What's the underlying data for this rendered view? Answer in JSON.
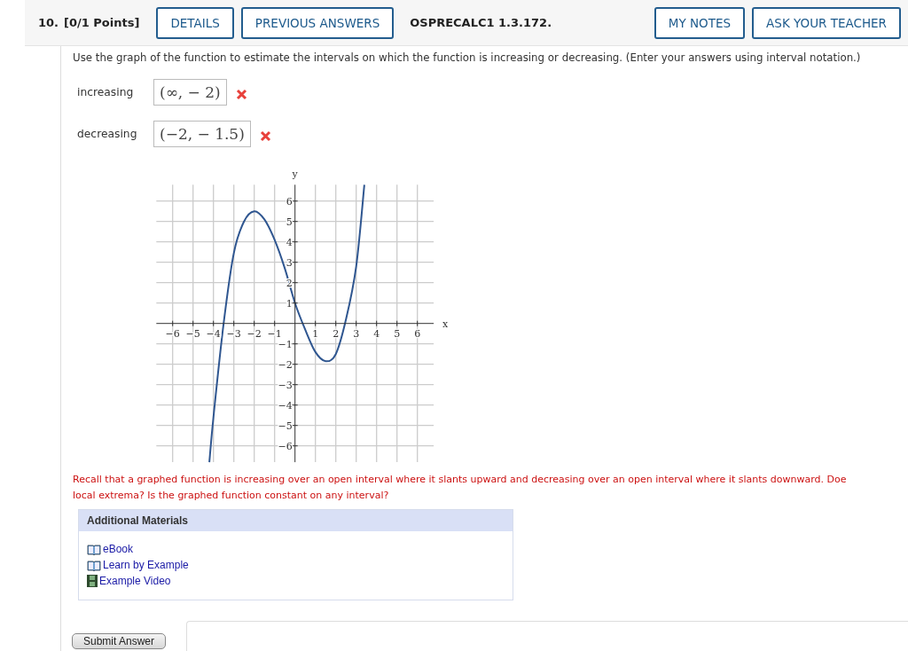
{
  "header": {
    "number": "10.",
    "points": "[0/1 Points]",
    "buttons": [
      {
        "label": "DETAILS"
      },
      {
        "label": "PREVIOUS ANSWERS"
      }
    ],
    "code": "OSPRECALC1 1.3.172.",
    "right_buttons": [
      {
        "label": "MY NOTES"
      },
      {
        "label": "ASK YOUR TEACHER"
      }
    ]
  },
  "question": "Use the graph of the function to estimate the intervals on which the function is increasing or decreasing. (Enter your answers using interval notation.)",
  "answers": [
    {
      "label": "increasing",
      "value": "(∞, − 2)",
      "correct": false
    },
    {
      "label": "decreasing",
      "value": "(−2, − 1.5)",
      "correct": false
    }
  ],
  "graph": {
    "chart_data": {
      "type": "line",
      "grid": true,
      "xlabel": "x",
      "ylabel": "y",
      "xlim": [
        -6.8,
        6.8
      ],
      "ylim": [
        -6.8,
        6.8
      ],
      "xticks": [
        -6,
        -5,
        -4,
        -3,
        -2,
        -1,
        1,
        2,
        3,
        4,
        5,
        6
      ],
      "yticks": [
        -6,
        -5,
        -4,
        -3,
        -2,
        -1,
        1,
        2,
        3,
        4,
        5,
        6
      ],
      "x": [
        -4.2,
        -4,
        -3.5,
        -3,
        -2.5,
        -2,
        -1.5,
        -1,
        -0.5,
        0,
        0.5,
        1,
        1.5,
        2,
        2.5,
        3,
        3.4
      ],
      "series": [
        {
          "color": "#2f5690",
          "values": [
            -6.8,
            -4.6,
            0,
            3.45,
            5.0,
            5.5,
            5.1,
            4.1,
            2.7,
            1.0,
            -0.3,
            -1.4,
            -1.85,
            -1.5,
            0.2,
            2.8,
            6.8
          ]
        }
      ]
    }
  },
  "hint_lines": [
    "Recall that a graphed function is increasing over an open interval where it slants upward and decreasing over an open interval where it slants downward. Doe",
    "local extrema? Is the graphed function constant on any interval?"
  ],
  "materials": {
    "title": "Additional Materials",
    "items": [
      {
        "kind": "book",
        "label": "eBook"
      },
      {
        "kind": "book",
        "label": "Learn by Example"
      },
      {
        "kind": "video",
        "label": "Example Video"
      }
    ]
  },
  "submit": "Submit Answer"
}
